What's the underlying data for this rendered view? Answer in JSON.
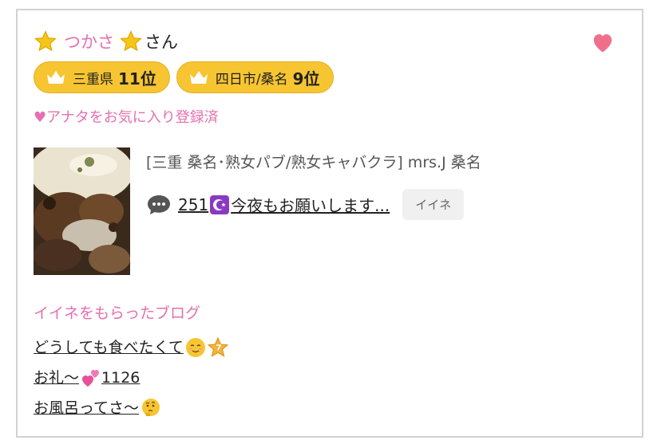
{
  "profile": {
    "name": "つかさ",
    "suffix": "さん"
  },
  "badges": [
    {
      "label": "三重県",
      "rank": "11位"
    },
    {
      "label": "四日市/桑名",
      "rank": "9位"
    }
  ],
  "favorite_status": "♥アナタをお気に入り登録済",
  "post": {
    "shop": "[三重 桑名･熟女パブ/熟女キャバクラ]  mrs.J 桑名",
    "text_before": "251",
    "text_after": "今夜もお願いします...",
    "iine_label": "イイネ"
  },
  "liked_blogs": {
    "title": "イイネをもらったブログ",
    "items": [
      {
        "text": "どうしても食べたくて"
      },
      {
        "text": "お礼〜",
        "text2": " 1126"
      },
      {
        "text": "お風呂ってさ〜"
      }
    ]
  },
  "colors": {
    "accent_pink": "#e56fb0",
    "badge_yellow": "#f7c531",
    "heart": "#f0708c"
  }
}
